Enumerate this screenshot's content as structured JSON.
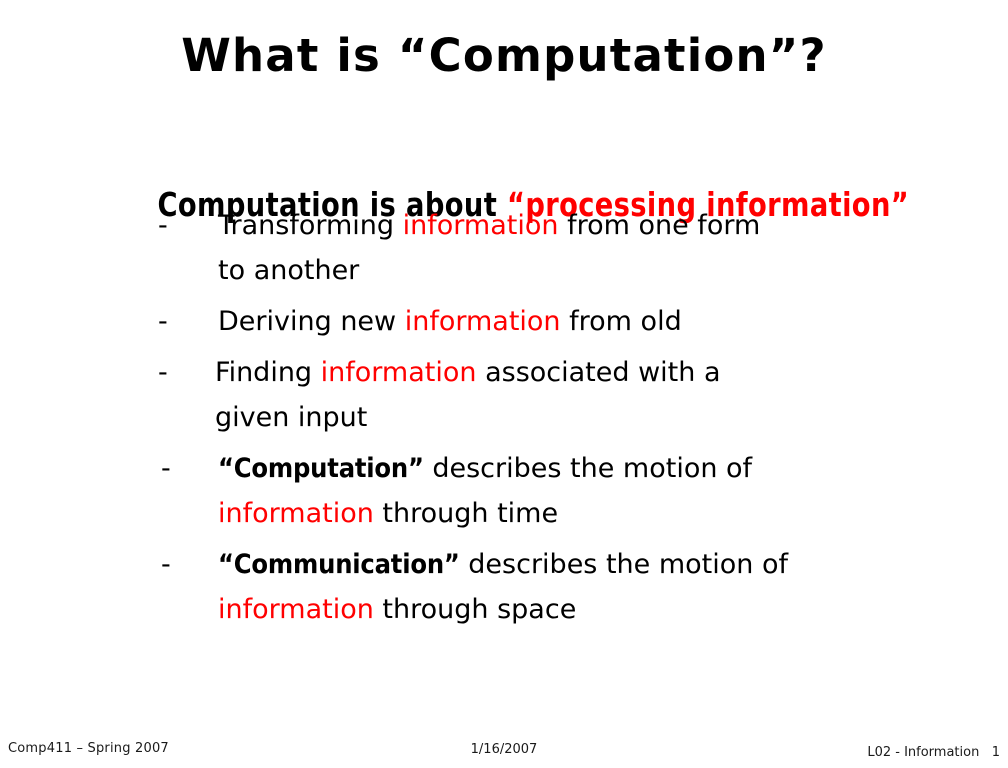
{
  "slide": {
    "title_prefix": "What is ",
    "title_quoted": "“Computation”",
    "title_suffix": "?",
    "title_full": "What is “Computation”?",
    "background_color": "#ffffff",
    "accent_color": "#ff0000",
    "text_color": "#000000"
  },
  "subtitle": {
    "lead": "Computation is about ",
    "highlight": "“processing information”"
  },
  "bullets": [
    {
      "marker": "-",
      "segments": [
        {
          "text": "Transforming ",
          "style": "plain"
        },
        {
          "text": "information",
          "style": "red"
        },
        {
          "text": " from one form",
          "style": "plain"
        }
      ],
      "line2": [
        {
          "text": "to another",
          "style": "plain"
        }
      ]
    },
    {
      "marker": "-",
      "segments": [
        {
          "text": "Deriving new ",
          "style": "plain"
        },
        {
          "text": "information",
          "style": "red"
        },
        {
          "text": " from old",
          "style": "plain"
        }
      ],
      "line2": []
    },
    {
      "marker": "-",
      "segments": [
        {
          "text": "Finding ",
          "style": "plain"
        },
        {
          "text": "information",
          "style": "red"
        },
        {
          "text": " associated with a",
          "style": "plain"
        }
      ],
      "line2": [
        {
          "text": "given input",
          "style": "plain"
        }
      ]
    },
    {
      "marker": "-",
      "segments": [
        {
          "text": "“Computation”",
          "style": "strong"
        },
        {
          "text": " describes the motion of",
          "style": "plain"
        }
      ],
      "line2": [
        {
          "text": "information",
          "style": "red"
        },
        {
          "text": " through time",
          "style": "plain"
        }
      ]
    },
    {
      "marker": "-",
      "segments": [
        {
          "text": "“Communication”",
          "style": "strong"
        },
        {
          "text": " describes the motion of",
          "style": "plain"
        }
      ],
      "line2": [
        {
          "text": "information",
          "style": "red"
        },
        {
          "text": " through space",
          "style": "plain"
        }
      ]
    }
  ],
  "footer": {
    "left": "Comp411 – Spring 2007",
    "center": "1/16/2007",
    "right": "L02 - Information   1"
  }
}
